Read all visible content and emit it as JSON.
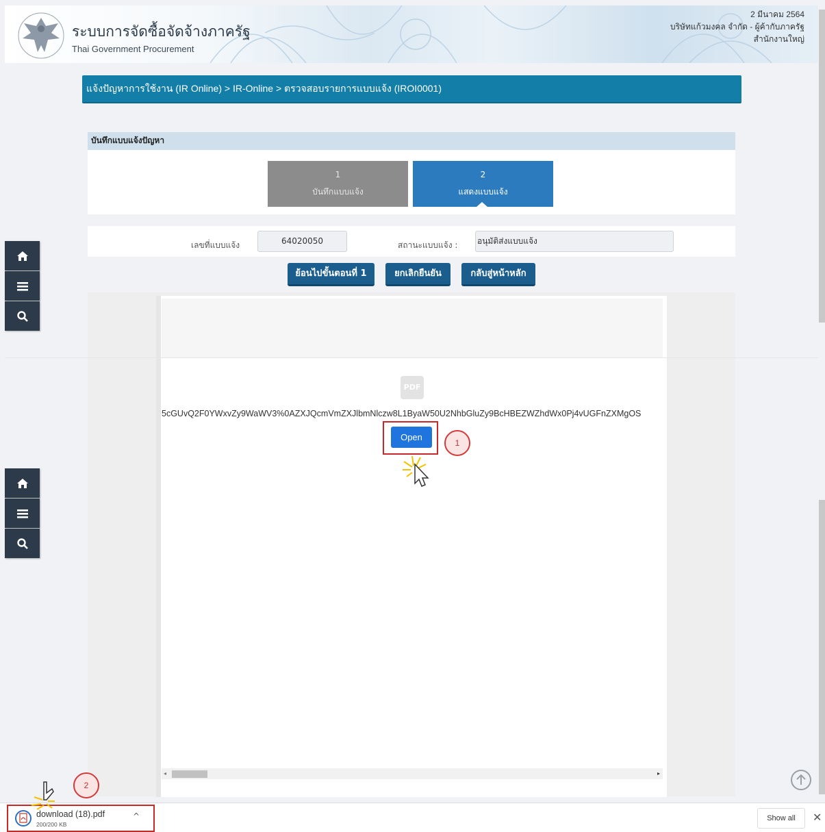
{
  "header": {
    "title_th": "ระบบการจัดซื้อจัดจ้างภาครัฐ",
    "title_en": "Thai Government Procurement",
    "date": "2 มีนาคม 2564",
    "company": "บริษัทแก้วมงคล จำกัด - ผู้ค้ากับภาครัฐ",
    "branch": "สำนักงานใหญ่"
  },
  "breadcrumb": "แจ้งปัญหาการใช้งาน (IR Online) > IR-Online > ตรวจสอบรายการแบบแจ้ง (IROI0001)",
  "section_title": "บันทึกแบบแจ้งปัญหา",
  "steps": [
    {
      "num": "1",
      "label": "บันทึกแบบแจ้ง",
      "state": "inactive"
    },
    {
      "num": "2",
      "label": "แสดงแบบแจ้ง",
      "state": "active"
    }
  ],
  "form": {
    "form_no_label": "เลขที่แบบแจ้ง",
    "form_no_value": "64020050",
    "status_label": "สถานะแบบแจ้ง :",
    "status_value": "อนุมัติส่งแบบแจ้ง"
  },
  "actions": {
    "back_step": "ย้อนไปขั้นตอนที่ 1",
    "cancel_confirm": "ยกเลิกยืนยัน",
    "home": "กลับสู่หน้าหลัก"
  },
  "viewer": {
    "pdf_label": "PDF",
    "blob_text": "5cGUvQ2F0YWxvZy9WaWV3%0AZXJQcmVmZXJlbmNlczw8L1ByaW50U2NhbGluZy9BcHBEZWZhdWx0Pj4vUGFnZXMgOS",
    "open_label": "Open"
  },
  "annotations": {
    "badge1": "1",
    "badge2": "2"
  },
  "download": {
    "filename": "download (18).pdf",
    "size": "200/200 KB",
    "show_all": "Show all",
    "close": "✕",
    "chevron": "^"
  },
  "icons": [
    "home-icon",
    "menu-icon",
    "search-icon",
    "pdf-icon",
    "cursor-icon",
    "arrow-up-icon",
    "close-icon"
  ],
  "colors": {
    "breadcrumb_bg": "#137fa8",
    "step_active": "#2d7bbf",
    "step_inactive": "#8c8c8c",
    "action_button": "#1b5e8e",
    "open_button": "#1f74de",
    "highlight": "#c8282a",
    "sidenav": "#2d3a4a"
  }
}
